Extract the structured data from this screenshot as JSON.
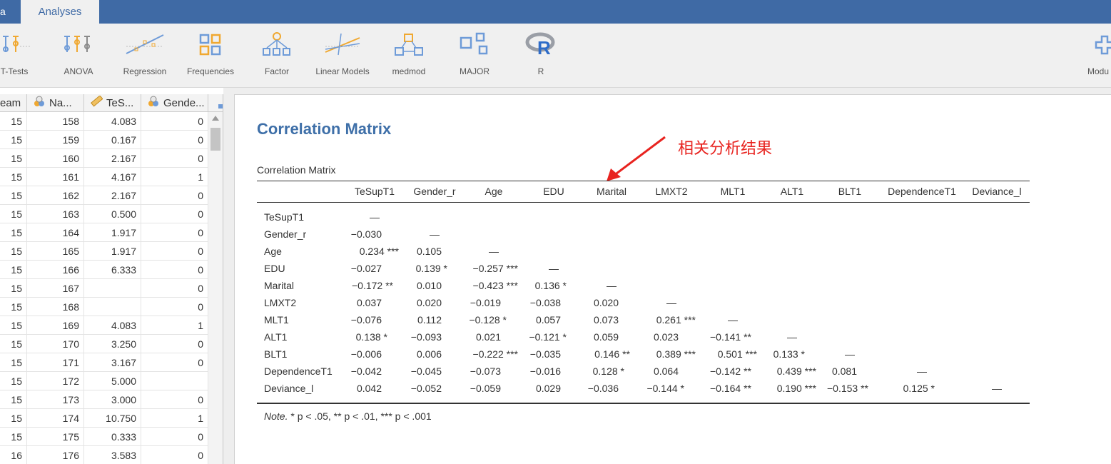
{
  "tabs": {
    "data_partial": "a",
    "analyses": "Analyses"
  },
  "ribbon": [
    {
      "label": "T-Tests",
      "icon": "t-tests-icon"
    },
    {
      "label": "ANOVA",
      "icon": "anova-icon"
    },
    {
      "label": "Regression",
      "icon": "regression-icon"
    },
    {
      "label": "Frequencies",
      "icon": "frequencies-icon"
    },
    {
      "label": "Factor",
      "icon": "factor-icon"
    },
    {
      "label": "Linear Models",
      "icon": "linear-models-icon"
    },
    {
      "label": "medmod",
      "icon": "medmod-icon"
    },
    {
      "label": "MAJOR",
      "icon": "major-icon"
    },
    {
      "label": "R",
      "icon": "r-icon"
    },
    {
      "label": "Modu",
      "icon": "modules-icon"
    }
  ],
  "grid": {
    "headers": [
      "eam",
      "Na...",
      "TeS...",
      "Gende..."
    ],
    "rows": [
      [
        "15",
        "158",
        "4.083",
        "0"
      ],
      [
        "15",
        "159",
        "0.167",
        "0"
      ],
      [
        "15",
        "160",
        "2.167",
        "0"
      ],
      [
        "15",
        "161",
        "4.167",
        "1"
      ],
      [
        "15",
        "162",
        "2.167",
        "0"
      ],
      [
        "15",
        "163",
        "0.500",
        "0"
      ],
      [
        "15",
        "164",
        "1.917",
        "0"
      ],
      [
        "15",
        "165",
        "1.917",
        "0"
      ],
      [
        "15",
        "166",
        "6.333",
        "0"
      ],
      [
        "15",
        "167",
        "",
        "0"
      ],
      [
        "15",
        "168",
        "",
        "0"
      ],
      [
        "15",
        "169",
        "4.083",
        "1"
      ],
      [
        "15",
        "170",
        "3.250",
        "0"
      ],
      [
        "15",
        "171",
        "3.167",
        "0"
      ],
      [
        "15",
        "172",
        "5.000",
        ""
      ],
      [
        "15",
        "173",
        "3.000",
        "0"
      ],
      [
        "15",
        "174",
        "10.750",
        "1"
      ],
      [
        "15",
        "175",
        "0.333",
        "0"
      ],
      [
        "16",
        "176",
        "3.583",
        "0"
      ]
    ]
  },
  "results": {
    "title": "Correlation Matrix",
    "annotation": "相关分析结果",
    "table_caption": "Correlation Matrix",
    "columns": [
      "TeSupT1",
      "Gender_r",
      "Age",
      "EDU",
      "Marital",
      "LMXT2",
      "MLT1",
      "ALT1",
      "BLT1",
      "DependenceT1",
      "Deviance_l"
    ],
    "rows": [
      {
        "label": "TeSupT1",
        "values": [
          "—"
        ]
      },
      {
        "label": "Gender_r",
        "values": [
          "−0.030",
          "—"
        ]
      },
      {
        "label": "Age",
        "values": [
          "0.234 ***",
          "0.105",
          "—"
        ]
      },
      {
        "label": "EDU",
        "values": [
          "−0.027",
          "0.139 *",
          "−0.257 ***",
          "—"
        ]
      },
      {
        "label": "Marital",
        "values": [
          "−0.172 **",
          "0.010",
          "−0.423 ***",
          "0.136 *",
          "—"
        ]
      },
      {
        "label": "LMXT2",
        "values": [
          "0.037",
          "0.020",
          "−0.019",
          "−0.038",
          "0.020",
          "—"
        ]
      },
      {
        "label": "MLT1",
        "values": [
          "−0.076",
          "0.112",
          "−0.128 *",
          "0.057",
          "0.073",
          "0.261 ***",
          "—"
        ]
      },
      {
        "label": "ALT1",
        "values": [
          "0.138 *",
          "−0.093",
          "0.021",
          "−0.121 *",
          "0.059",
          "0.023",
          "−0.141 **",
          "—"
        ]
      },
      {
        "label": "BLT1",
        "values": [
          "−0.006",
          "0.006",
          "−0.222 ***",
          "−0.035",
          "0.146 **",
          "0.389 ***",
          "0.501 ***",
          "0.133 *",
          "—"
        ]
      },
      {
        "label": "DependenceT1",
        "values": [
          "−0.042",
          "−0.045",
          "−0.073",
          "−0.016",
          "0.128 *",
          "0.064",
          "−0.142 **",
          "0.439 ***",
          "0.081",
          "—"
        ]
      },
      {
        "label": "Deviance_l",
        "values": [
          "0.042",
          "−0.052",
          "−0.059",
          "0.029",
          "−0.036",
          "−0.144 *",
          "−0.164 **",
          "0.190 ***",
          "−0.153 **",
          "0.125 *",
          "—"
        ]
      }
    ],
    "note_label": "Note.",
    "note_text": " * p < .05, ** p < .01, *** p < .001"
  }
}
